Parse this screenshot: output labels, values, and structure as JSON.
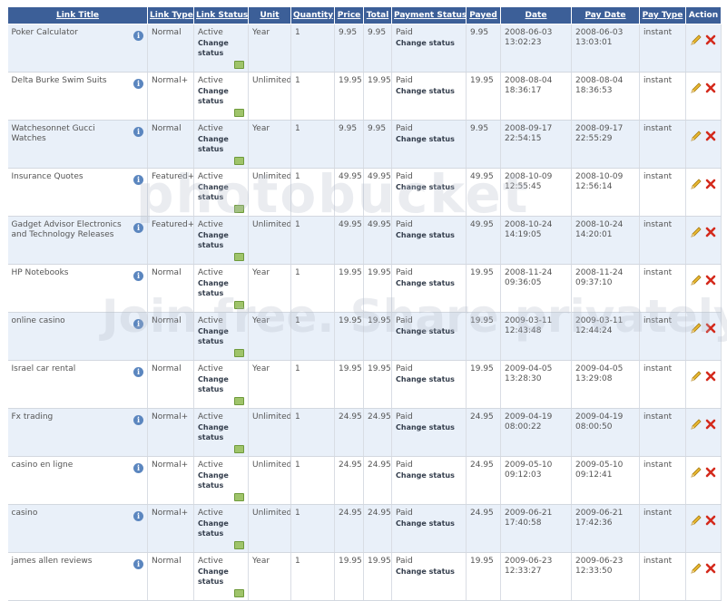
{
  "table": {
    "headers": [
      "Link Title",
      "Link Type",
      "Link Status",
      "Unit",
      "Quantity",
      "Price",
      "Total",
      "Payment Status",
      "Payed",
      "Date",
      "Pay Date",
      "Pay Type",
      "Action"
    ],
    "change_label": "Change status",
    "rows": [
      {
        "title": "Poker Calculator",
        "type": "Normal",
        "status": "Active",
        "unit": "Year",
        "quantity": "1",
        "price": "9.95",
        "total": "9.95",
        "payment": "Paid",
        "payed": "9.95",
        "date": "2008-06-03 13:02:23",
        "pay_date": "2008-06-03 13:03:01",
        "pay_type": "instant"
      },
      {
        "title": "Delta Burke Swim Suits",
        "type": "Normal+",
        "status": "Active",
        "unit": "Unlimited",
        "quantity": "1",
        "price": "19.95",
        "total": "19.95",
        "payment": "Paid",
        "payed": "19.95",
        "date": "2008-08-04 18:36:17",
        "pay_date": "2008-08-04 18:36:53",
        "pay_type": "instant"
      },
      {
        "title": "Watchesonnet Gucci Watches",
        "type": "Normal",
        "status": "Active",
        "unit": "Year",
        "quantity": "1",
        "price": "9.95",
        "total": "9.95",
        "payment": "Paid",
        "payed": "9.95",
        "date": "2008-09-17 22:54:15",
        "pay_date": "2008-09-17 22:55:29",
        "pay_type": "instant"
      },
      {
        "title": "Insurance Quotes",
        "type": "Featured+",
        "status": "Active",
        "unit": "Unlimited",
        "quantity": "1",
        "price": "49.95",
        "total": "49.95",
        "payment": "Paid",
        "payed": "49.95",
        "date": "2008-10-09 12:55:45",
        "pay_date": "2008-10-09 12:56:14",
        "pay_type": "instant"
      },
      {
        "title": "Gadget Advisor Electronics and Technology Releases",
        "type": "Featured+",
        "status": "Active",
        "unit": "Unlimited",
        "quantity": "1",
        "price": "49.95",
        "total": "49.95",
        "payment": "Paid",
        "payed": "49.95",
        "date": "2008-10-24 14:19:05",
        "pay_date": "2008-10-24 14:20:01",
        "pay_type": "instant"
      },
      {
        "title": "HP Notebooks",
        "type": "Normal",
        "status": "Active",
        "unit": "Year",
        "quantity": "1",
        "price": "19.95",
        "total": "19.95",
        "payment": "Paid",
        "payed": "19.95",
        "date": "2008-11-24 09:36:05",
        "pay_date": "2008-11-24 09:37:10",
        "pay_type": "instant"
      },
      {
        "title": "online casino",
        "type": "Normal",
        "status": "Active",
        "unit": "Year",
        "quantity": "1",
        "price": "19.95",
        "total": "19.95",
        "payment": "Paid",
        "payed": "19.95",
        "date": "2009-03-11 12:43:48",
        "pay_date": "2009-03-11 12:44:24",
        "pay_type": "instant"
      },
      {
        "title": "Israel car rental",
        "type": "Normal",
        "status": "Active",
        "unit": "Year",
        "quantity": "1",
        "price": "19.95",
        "total": "19.95",
        "payment": "Paid",
        "payed": "19.95",
        "date": "2009-04-05 13:28:30",
        "pay_date": "2009-04-05 13:29:08",
        "pay_type": "instant"
      },
      {
        "title": "Fx trading",
        "type": "Normal+",
        "status": "Active",
        "unit": "Unlimited",
        "quantity": "1",
        "price": "24.95",
        "total": "24.95",
        "payment": "Paid",
        "payed": "24.95",
        "date": "2009-04-19 08:00:22",
        "pay_date": "2009-04-19 08:00:50",
        "pay_type": "instant"
      },
      {
        "title": "casino en ligne",
        "type": "Normal+",
        "status": "Active",
        "unit": "Unlimited",
        "quantity": "1",
        "price": "24.95",
        "total": "24.95",
        "payment": "Paid",
        "payed": "24.95",
        "date": "2009-05-10 09:12:03",
        "pay_date": "2009-05-10 09:12:41",
        "pay_type": "instant"
      },
      {
        "title": "casino",
        "type": "Normal+",
        "status": "Active",
        "unit": "Unlimited",
        "quantity": "1",
        "price": "24.95",
        "total": "24.95",
        "payment": "Paid",
        "payed": "24.95",
        "date": "2009-06-21 17:40:58",
        "pay_date": "2009-06-21 17:42:36",
        "pay_type": "instant"
      },
      {
        "title": "james allen reviews",
        "type": "Normal",
        "status": "Active",
        "unit": "Year",
        "quantity": "1",
        "price": "19.95",
        "total": "19.95",
        "payment": "Paid",
        "payed": "19.95",
        "date": "2009-06-23 12:33:27",
        "pay_date": "2009-06-23 12:33:50",
        "pay_type": "instant"
      }
    ]
  },
  "icons": {
    "info": "info-icon",
    "tag": "tag-icon",
    "edit": "pencil-icon",
    "delete": "delete-icon"
  },
  "colors": {
    "header_bg": "#3c5f98",
    "row_alt_bg": "#e9f0f9",
    "delete_red": "#d42a1c",
    "edit_yellow": "#e8b830"
  }
}
